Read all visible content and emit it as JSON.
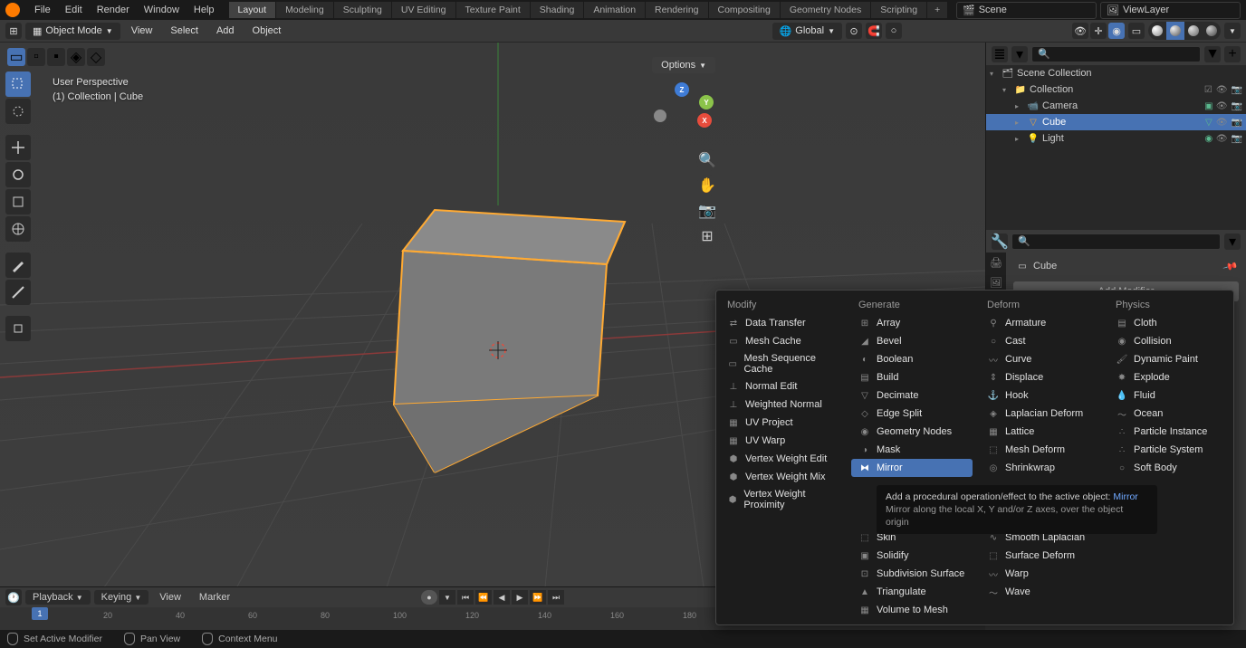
{
  "topbar": {
    "menus": [
      "File",
      "Edit",
      "Render",
      "Window",
      "Help"
    ],
    "workspaces": [
      "Layout",
      "Modeling",
      "Sculpting",
      "UV Editing",
      "Texture Paint",
      "Shading",
      "Animation",
      "Rendering",
      "Compositing",
      "Geometry Nodes",
      "Scripting"
    ],
    "active_workspace": "Layout",
    "scene": "Scene",
    "viewlayer": "ViewLayer"
  },
  "viewport_header": {
    "mode": "Object Mode",
    "menus": [
      "View",
      "Select",
      "Add",
      "Object"
    ],
    "orientation": "Global",
    "options_label": "Options"
  },
  "viewport_info": {
    "line1": "User Perspective",
    "line2": "(1) Collection | Cube"
  },
  "outliner": {
    "root": "Scene Collection",
    "collection": "Collection",
    "items": [
      {
        "name": "Camera",
        "selected": false
      },
      {
        "name": "Cube",
        "selected": true
      },
      {
        "name": "Light",
        "selected": false
      }
    ]
  },
  "properties": {
    "active_object": "Cube",
    "add_modifier_label": "Add Modifier"
  },
  "modifier_menu": {
    "columns": [
      {
        "header": "Modify",
        "items": [
          "Data Transfer",
          "Mesh Cache",
          "Mesh Sequence Cache",
          "Normal Edit",
          "Weighted Normal",
          "UV Project",
          "UV Warp",
          "Vertex Weight Edit",
          "Vertex Weight Mix",
          "Vertex Weight Proximity"
        ]
      },
      {
        "header": "Generate",
        "items": [
          "Array",
          "Bevel",
          "Boolean",
          "Build",
          "Decimate",
          "Edge Split",
          "Geometry Nodes",
          "Mask",
          "Mirror",
          "",
          "",
          "",
          "Skin",
          "Solidify",
          "Subdivision Surface",
          "Triangulate",
          "Volume to Mesh"
        ]
      },
      {
        "header": "Deform",
        "items": [
          "Armature",
          "Cast",
          "Curve",
          "Displace",
          "Hook",
          "Laplacian Deform",
          "Lattice",
          "Mesh Deform",
          "Shrinkwrap",
          "",
          "",
          "",
          "Smooth Laplacian",
          "Surface Deform",
          "Warp",
          "Wave"
        ]
      },
      {
        "header": "Physics",
        "items": [
          "Cloth",
          "Collision",
          "Dynamic Paint",
          "Explode",
          "Fluid",
          "Ocean",
          "Particle Instance",
          "Particle System",
          "Soft Body"
        ]
      }
    ],
    "highlighted": "Mirror"
  },
  "tooltip": {
    "main": "Add a procedural operation/effect to the active object:",
    "link": "Mirror",
    "sub": "Mirror along the local X, Y and/or Z axes, over the object origin"
  },
  "timeline": {
    "buttons": [
      "Playback",
      "Keying",
      "View",
      "Marker"
    ],
    "ticks": [
      20,
      40,
      60,
      80,
      100,
      120,
      140,
      160,
      180
    ],
    "current_frame": 1
  },
  "status_bar": {
    "items": [
      "Set Active Modifier",
      "Pan View",
      "Context Menu"
    ]
  }
}
